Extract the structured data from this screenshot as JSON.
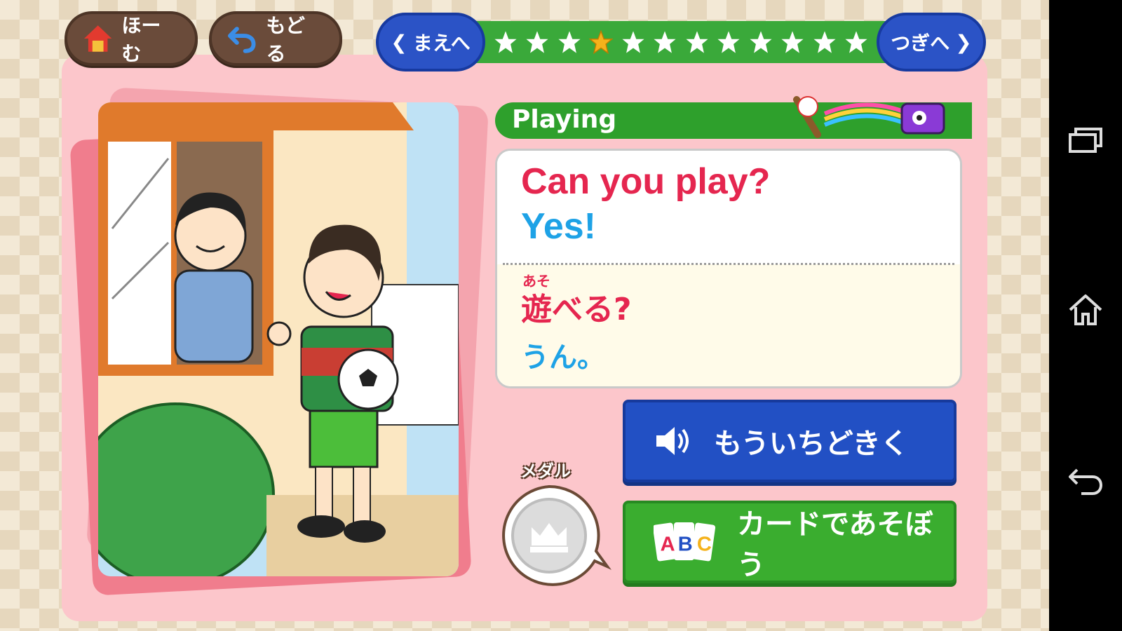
{
  "header": {
    "home_label": "ほーむ",
    "back_label": "もどる"
  },
  "stepper": {
    "prev_label": "まえへ",
    "next_label": "つぎへ",
    "total_steps": 12,
    "current_step": 4
  },
  "scene": {
    "category_label": "Playing",
    "english_line_1": "Can you play?",
    "english_line_2": "Yes!",
    "furigana": "あそ",
    "japanese_line_1": "遊べる?",
    "japanese_line_2": "うん。"
  },
  "actions": {
    "listen_again_label": "もういちどきく",
    "card_game_label": "カードであそぼう",
    "card_icon_text": "ABC"
  },
  "medal": {
    "label": "メダル",
    "icon": "crown-icon"
  },
  "system_nav": {
    "icons": [
      "recent-apps-icon",
      "home-icon",
      "back-icon"
    ]
  },
  "colors": {
    "panel_pink": "#fcc6cb",
    "primary_blue": "#2250c4",
    "primary_green": "#3aad2f",
    "english_red": "#e5264f",
    "english_blue": "#1ea2e6",
    "star_active": "#f5b21b"
  }
}
